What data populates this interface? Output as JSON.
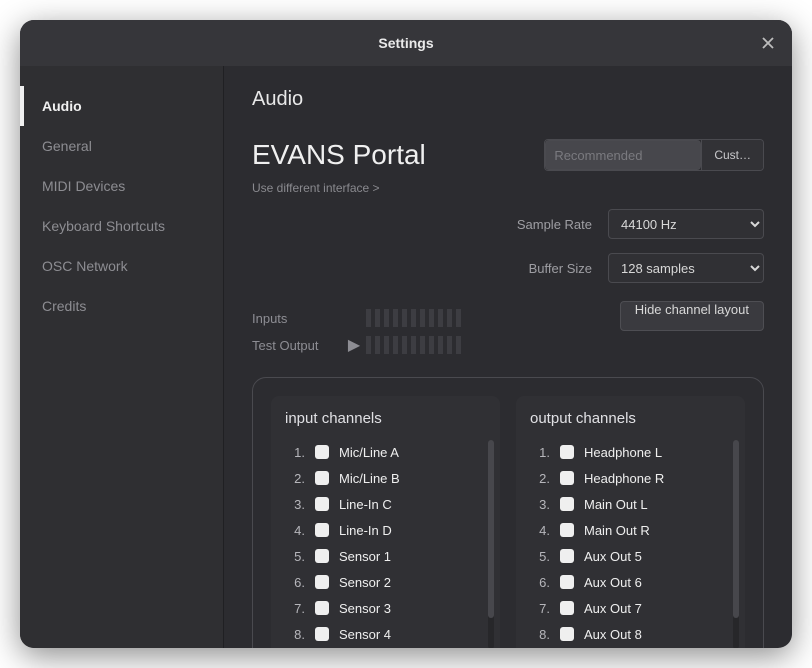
{
  "title": "Settings",
  "sidebar": {
    "items": [
      {
        "label": "Audio",
        "active": true
      },
      {
        "label": "General"
      },
      {
        "label": "MIDI Devices"
      },
      {
        "label": "Keyboard Shortcuts"
      },
      {
        "label": "OSC Network"
      },
      {
        "label": "Credits"
      }
    ]
  },
  "page": {
    "heading": "Audio",
    "interface_name": "EVANS Portal",
    "interface_sub": "Use different interface >",
    "seg_recommended": "Recommended",
    "seg_custom": "Cust…",
    "sample_rate_label": "Sample Rate",
    "sample_rate_value": "44100 Hz",
    "buffer_label": "Buffer Size",
    "buffer_value": "128 samples",
    "inputs_label": "Inputs",
    "test_output_label": "Test Output",
    "hide_btn": "Hide channel layout",
    "inputs_heading": "input channels",
    "outputs_heading": "output channels",
    "input_channels": [
      "Mic/Line A",
      "Mic/Line B",
      "Line-In C",
      "Line-In D",
      "Sensor 1",
      "Sensor 2",
      "Sensor 3",
      "Sensor 4"
    ],
    "output_channels": [
      "Headphone L",
      "Headphone R",
      "Main Out L",
      "Main Out R",
      "Aux Out 5",
      "Aux Out 6",
      "Aux Out 7",
      "Aux Out 8"
    ]
  }
}
